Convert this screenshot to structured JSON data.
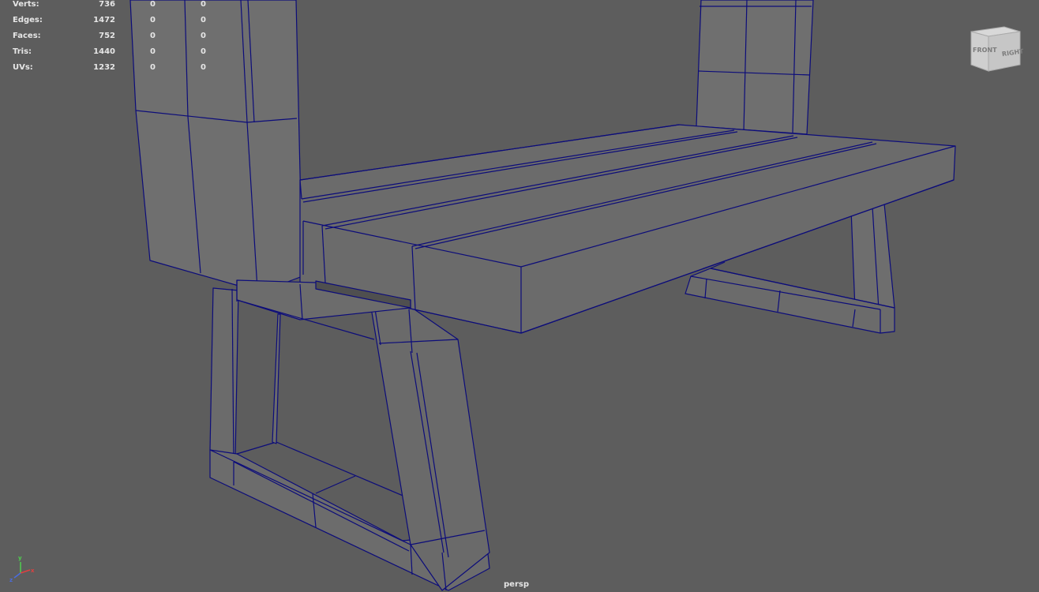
{
  "hud": {
    "rows": [
      {
        "label": "Verts:",
        "c1": "736",
        "c2": "0",
        "c3": "0"
      },
      {
        "label": "Edges:",
        "c1": "1472",
        "c2": "0",
        "c3": "0"
      },
      {
        "label": "Faces:",
        "c1": "752",
        "c2": "0",
        "c3": "0"
      },
      {
        "label": "Tris:",
        "c1": "1440",
        "c2": "0",
        "c3": "0"
      },
      {
        "label": "UVs:",
        "c1": "1232",
        "c2": "0",
        "c3": "0"
      }
    ]
  },
  "viewcube": {
    "front": "FRONT",
    "right": "RIGHT"
  },
  "axis": {
    "x": "x",
    "y": "y",
    "z": "z"
  },
  "camera": {
    "name": "persp"
  },
  "colors": {
    "viewport": "#5d5d5d",
    "wire": "#0c0c7a",
    "face": "#6d6d6d",
    "hud_text": "#e6e6e6"
  }
}
